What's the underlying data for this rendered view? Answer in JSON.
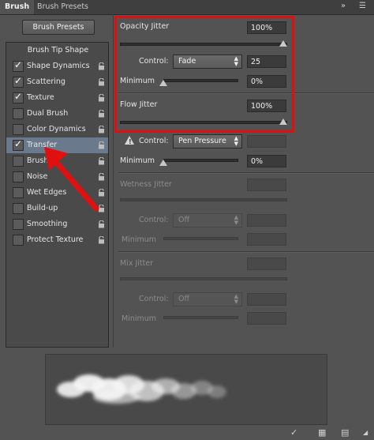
{
  "tabs": [
    {
      "label": "Brush",
      "active": true
    },
    {
      "label": "Brush Presets",
      "active": false
    }
  ],
  "tabbar_icons": [
    "double-chevron-right-icon",
    "panel-menu-icon"
  ],
  "left": {
    "presets_button": "Brush Presets",
    "tip_shape": "Brush Tip Shape",
    "items": [
      {
        "label": "Shape Dynamics",
        "checked": true
      },
      {
        "label": "Scattering",
        "checked": true
      },
      {
        "label": "Texture",
        "checked": true
      },
      {
        "label": "Dual Brush",
        "checked": false
      },
      {
        "label": "Color Dynamics",
        "checked": false
      },
      {
        "label": "Transfer",
        "checked": true,
        "selected": true
      },
      {
        "label": "Brush",
        "checked": false
      },
      {
        "label": "Noise",
        "checked": false
      },
      {
        "label": "Wet Edges",
        "checked": false
      },
      {
        "label": "Build-up",
        "checked": false
      },
      {
        "label": "Smoothing",
        "checked": false
      },
      {
        "label": "Protect Texture",
        "checked": false
      }
    ]
  },
  "right": {
    "opacity_jitter": {
      "label": "Opacity Jitter",
      "value": "100%",
      "slider": 1.0
    },
    "opacity_control": {
      "label": "Control:",
      "value": "Fade",
      "number": "25"
    },
    "opacity_minimum": {
      "label": "Minimum",
      "value": "0%",
      "slider": 0.0
    },
    "flow_jitter": {
      "label": "Flow Jitter",
      "value": "100%",
      "slider": 1.0
    },
    "flow_control": {
      "label": "Control:",
      "value": "Pen Pressure",
      "number": ""
    },
    "flow_minimum": {
      "label": "Minimum",
      "value": "0%",
      "slider": 0.0
    },
    "wetness_jitter": {
      "label": "Wetness Jitter"
    },
    "wetness_control": {
      "label": "Control:",
      "value": "Off"
    },
    "wetness_minimum": {
      "label": "Minimum"
    },
    "mix_jitter": {
      "label": "Mix Jitter"
    },
    "mix_control": {
      "label": "Control:",
      "value": "Off"
    },
    "mix_minimum": {
      "label": "Minimum"
    }
  },
  "bottom_icons": [
    "brush-check-icon",
    "grid-icon",
    "new-preset-icon"
  ],
  "colors": {
    "highlight": "#e01010",
    "selected_row": "#6a7a8c",
    "panel": "#535353"
  }
}
